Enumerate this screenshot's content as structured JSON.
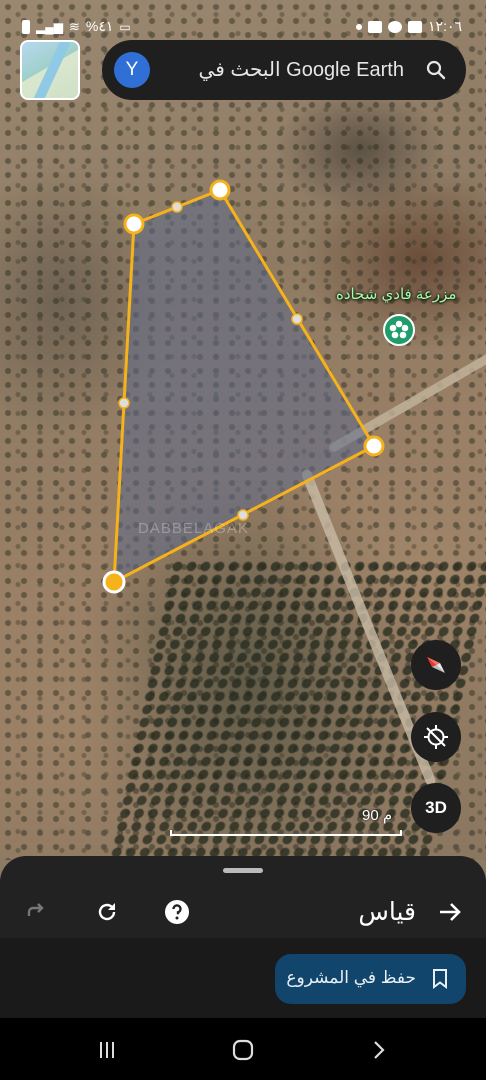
{
  "status_bar": {
    "time": "١٢:٠٦",
    "battery": "%٤١"
  },
  "search": {
    "avatar_letter": "Y",
    "text": "البحث في Google Earth"
  },
  "map": {
    "place_label": "مزرعة فادي شحاده",
    "watermark": "DABBELAGAK",
    "scale_label": "90 م",
    "polygon_stroke_color": "#f5b21b",
    "polygon_fill_color": "#5d6a8a"
  },
  "controls": {
    "view_3d_label": "3D"
  },
  "sheet": {
    "title": "قياس",
    "save_label": "حفظ في المشروع"
  },
  "colors": {
    "sheet_bg": "#222222",
    "save_button_bg": "#11456b",
    "avatar_bg": "#2f6fd6",
    "place_pin": "#1e9d6a",
    "place_label": "#9dffa6"
  }
}
